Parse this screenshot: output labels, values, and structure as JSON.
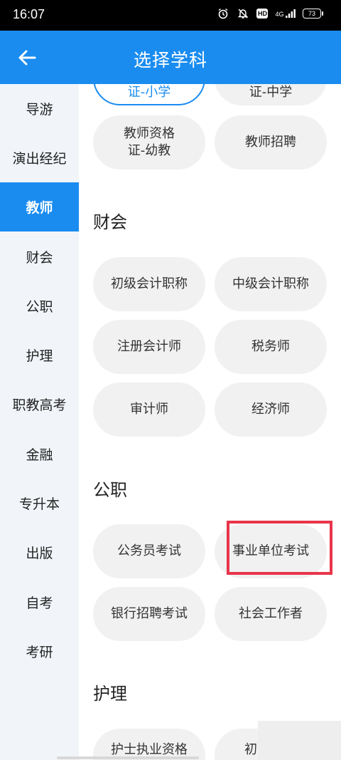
{
  "status_bar": {
    "time": "16:07",
    "icons": [
      "alarm-icon",
      "mute-icon",
      "hd-icon",
      "signal-icon"
    ],
    "hd": "HD",
    "network": "4G",
    "battery": "73"
  },
  "header": {
    "title": "选择学科",
    "back_icon": "arrow-left-icon",
    "background": "#1a8cf0"
  },
  "sidebar": {
    "active_color": "#1a8cf0",
    "items": [
      {
        "label": "导游"
      },
      {
        "label": "演出经纪"
      },
      {
        "label": "教师",
        "active": true
      },
      {
        "label": "财会"
      },
      {
        "label": "公职"
      },
      {
        "label": "护理"
      },
      {
        "label": "职教高考"
      },
      {
        "label": "金融"
      },
      {
        "label": "专升本"
      },
      {
        "label": "出版"
      },
      {
        "label": "自考"
      },
      {
        "label": "考研"
      }
    ]
  },
  "main": {
    "teacher_partial": {
      "items": [
        {
          "label": "证-小学",
          "selected": true
        },
        {
          "label": "证-中学"
        },
        {
          "label": "教师资格\n证-幼教"
        },
        {
          "label": "教师招聘"
        }
      ]
    },
    "sections": [
      {
        "title": "财会",
        "items": [
          {
            "label": "初级会计职称"
          },
          {
            "label": "中级会计职称"
          },
          {
            "label": "注册会计师"
          },
          {
            "label": "税务师"
          },
          {
            "label": "审计师"
          },
          {
            "label": "经济师"
          }
        ]
      },
      {
        "title": "公职",
        "items": [
          {
            "label": "公务员考试"
          },
          {
            "label": "事业单位考试",
            "highlighted": true
          },
          {
            "label": "银行招聘考试"
          },
          {
            "label": "社会工作者"
          }
        ]
      },
      {
        "title": "护理",
        "items": [
          {
            "label": "护士执业资格"
          },
          {
            "label": "初"
          }
        ]
      }
    ]
  },
  "highlight_color": "#e8354a"
}
